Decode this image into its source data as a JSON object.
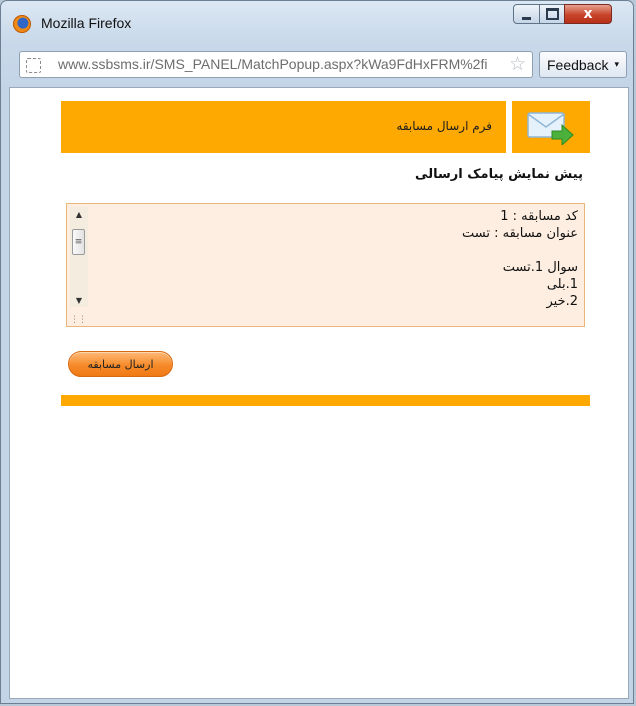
{
  "window": {
    "title": "Mozilla Firefox",
    "controls": {
      "minimize": "",
      "maximize": "",
      "close": "x"
    }
  },
  "toolbar": {
    "url": "www.ssbsms.ir/SMS_PANEL/MatchPopup.aspx?kWa9FdHxFRM%2fi",
    "feedback_label": "Feedback",
    "feedback_arrow": "▾"
  },
  "page": {
    "header_title": "فرم ارسال مسابقه",
    "preview_title": "پیش نمایش پیامک ارسالی",
    "message_text": "کد مسابقه : 1\nعنوان مسابقه : تست\n\nسوال 1.تست\n1.بلی\n2.خیر",
    "send_button": "ارسال مسابقه"
  },
  "colors": {
    "accent": "#fda902",
    "message_background": "#fdeee1",
    "button": "#f68b2a"
  },
  "icons": {
    "browser": "firefox-icon",
    "site": "page-icon",
    "bookmark": "star-icon",
    "header": "mail-send-icon"
  }
}
